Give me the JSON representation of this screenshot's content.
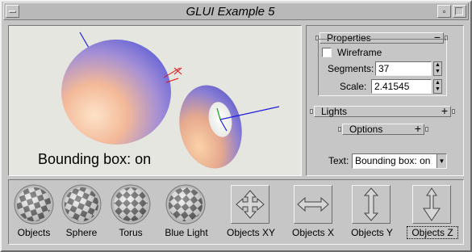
{
  "window": {
    "title": "GLUI Example 5"
  },
  "viewport": {
    "overlay_text": "Bounding box: on"
  },
  "panel": {
    "properties": {
      "title": "Properties",
      "toggle_symbol": "−",
      "wireframe_label": "Wireframe",
      "wireframe_checked": false,
      "segments_label": "Segments:",
      "segments_value": "37",
      "scale_label": "Scale:",
      "scale_value": "2.41545"
    },
    "lights": {
      "title": "Lights",
      "toggle_symbol": "+"
    },
    "options": {
      "title": "Options",
      "toggle_symbol": "+"
    },
    "text_control": {
      "label": "Text:",
      "selected": "Bounding box: on"
    }
  },
  "controls": {
    "rotations": [
      {
        "label": "Objects"
      },
      {
        "label": "Sphere"
      },
      {
        "label": "Torus"
      },
      {
        "label": "Blue Light"
      }
    ],
    "translations": [
      {
        "label": "Objects XY"
      },
      {
        "label": "Objects X"
      },
      {
        "label": "Objects Y"
      },
      {
        "label": "Objects Z"
      }
    ]
  },
  "colors": {
    "window_bg": "#c6c6c6",
    "viewport_bg": "#e5e6e0",
    "shape_light": "#f9c79a",
    "shape_dark": "#6a6ad8"
  }
}
